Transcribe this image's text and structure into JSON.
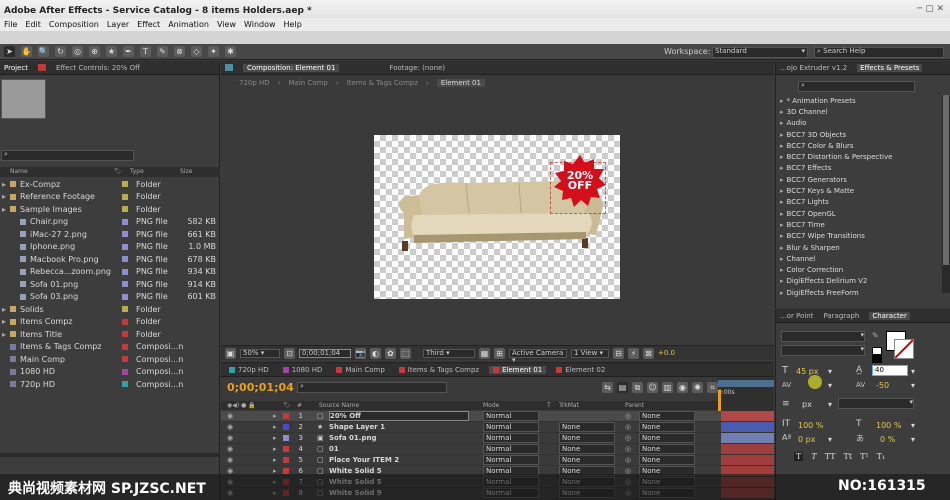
{
  "window": {
    "title": "Adobe After Effects - Service Catalog - 8 items Holders.aep *"
  },
  "menu": [
    "File",
    "Edit",
    "Composition",
    "Layer",
    "Effect",
    "Animation",
    "View",
    "Window",
    "Help"
  ],
  "toolbar": {
    "workspace_label": "Workspace:",
    "workspace_value": "Standard",
    "search_placeholder": "Search Help"
  },
  "project": {
    "tab_project": "Project",
    "tab_effect_controls": "Effect Controls: 20% Off",
    "search_placeholder": "",
    "headers": {
      "name": "Name",
      "type": "Type",
      "size": "Size"
    },
    "items": [
      {
        "name": "Ex-Compz",
        "type": "Folder",
        "size": "",
        "indent": 0,
        "kind": "folder",
        "color": "#b8b045"
      },
      {
        "name": "Reference Footage",
        "type": "Folder",
        "size": "",
        "indent": 0,
        "kind": "folder",
        "color": "#b8b045"
      },
      {
        "name": "Sample Images",
        "type": "Folder",
        "size": "",
        "indent": 0,
        "kind": "folder",
        "color": "#b8b045"
      },
      {
        "name": "Chair.png",
        "type": "PNG file",
        "size": "582 KB",
        "indent": 1,
        "kind": "file",
        "color": "#8e8ecf"
      },
      {
        "name": "iMac-27 2.png",
        "type": "PNG file",
        "size": "661 KB",
        "indent": 1,
        "kind": "file",
        "color": "#8e8ecf"
      },
      {
        "name": "Iphone.png",
        "type": "PNG file",
        "size": "1.0 MB",
        "indent": 1,
        "kind": "file",
        "color": "#8e8ecf"
      },
      {
        "name": "Macbook Pro.png",
        "type": "PNG file",
        "size": "678 KB",
        "indent": 1,
        "kind": "file",
        "color": "#8e8ecf"
      },
      {
        "name": "Rebecca...zoom.png",
        "type": "PNG file",
        "size": "934 KB",
        "indent": 1,
        "kind": "file",
        "color": "#8e8ecf"
      },
      {
        "name": "Sofa 01.png",
        "type": "PNG file",
        "size": "914 KB",
        "indent": 1,
        "kind": "file",
        "color": "#8e8ecf"
      },
      {
        "name": "Sofa 03.png",
        "type": "PNG file",
        "size": "601 KB",
        "indent": 1,
        "kind": "file",
        "color": "#8e8ecf"
      },
      {
        "name": "Solids",
        "type": "Folder",
        "size": "",
        "indent": 0,
        "kind": "folder",
        "color": "#b8b045"
      },
      {
        "name": "Items Compz",
        "type": "Folder",
        "size": "",
        "indent": 0,
        "kind": "folder",
        "color": "#c23b3b"
      },
      {
        "name": "Items Title",
        "type": "Folder",
        "size": "",
        "indent": 0,
        "kind": "folder",
        "color": "#c23b3b"
      },
      {
        "name": "Items & Tags Compz",
        "type": "Composi...n",
        "size": "",
        "indent": 0,
        "kind": "comp",
        "color": "#c23b3b"
      },
      {
        "name": "Main Comp",
        "type": "Composi...n",
        "size": "",
        "indent": 0,
        "kind": "comp",
        "color": "#c23b3b"
      },
      {
        "name": "1080 HD",
        "type": "Composi...n",
        "size": "",
        "indent": 0,
        "kind": "comp",
        "color": "#a742a7"
      },
      {
        "name": "720p HD",
        "type": "Composi...n",
        "size": "",
        "indent": 0,
        "kind": "comp",
        "color": "#2fa3a3"
      }
    ]
  },
  "comp_viewer": {
    "tab_comp": "Composition: Element 01",
    "tab_footage": "Footage: (none)",
    "breadcrumbs": [
      "720p HD",
      "Main Comp",
      "Items & Tags Compz",
      "Element 01"
    ],
    "badge": "20% OFF",
    "zoom": "50%",
    "time": "0;00;01;04",
    "resolution": "Third",
    "camera": "Active Camera",
    "view": "1 View",
    "exposure": "+0.0"
  },
  "timeline": {
    "tabs": [
      "720p HD",
      "1080 HD",
      "Main Comp",
      "Items & Tags Compz",
      "Element 01",
      "Element 02"
    ],
    "active_tab": "Element 01",
    "current_time": "0;00;01;04",
    "search_placeholder": "",
    "headers": {
      "source": "Source Name",
      "mode": "Mode",
      "t": "T",
      "trkmat": "TrkMat",
      "parent": "Parent"
    },
    "ruler_start": "0:00s",
    "layers": [
      {
        "num": "1",
        "name": "20% Off",
        "mode": "Normal",
        "trkmat": "",
        "parent": "None",
        "color": "#c23b3b",
        "bar": "#b04848",
        "selected": true
      },
      {
        "num": "2",
        "name": "Shape Layer 1",
        "mode": "Normal",
        "trkmat": "None",
        "parent": "None",
        "color": "#4a4acf",
        "bar": "#4a5cb0",
        "selected": false
      },
      {
        "num": "3",
        "name": "Sofa 01.png",
        "mode": "Normal",
        "trkmat": "None",
        "parent": "None",
        "color": "#8e8ecf",
        "bar": "#6f7fb0",
        "selected": false
      },
      {
        "num": "4",
        "name": "01",
        "mode": "Normal",
        "trkmat": "None",
        "parent": "None",
        "color": "#c23b3b",
        "bar": "#a03d3d",
        "selected": false
      },
      {
        "num": "5",
        "name": "Place Your ITEM 2",
        "mode": "Normal",
        "trkmat": "None",
        "parent": "None",
        "color": "#c23b3b",
        "bar": "#a03d3d",
        "selected": false
      },
      {
        "num": "6",
        "name": "White Solid 5",
        "mode": "Normal",
        "trkmat": "None",
        "parent": "None",
        "color": "#c23b3b",
        "bar": "#a03d3d",
        "selected": false
      },
      {
        "num": "7",
        "name": "White Solid 5",
        "mode": "Normal",
        "trkmat": "None",
        "parent": "None",
        "color": "#c23b3b",
        "bar": "#a03d3d",
        "selected": false
      },
      {
        "num": "8",
        "name": "White Solid 9",
        "mode": "Normal",
        "trkmat": "None",
        "parent": "None",
        "color": "#c23b3b",
        "bar": "#a03d3d",
        "selected": false
      }
    ]
  },
  "effects": {
    "tab_extruder": "...ojo Extruder v1.2",
    "tab_effects": "Effects & Presets",
    "search_placeholder": "",
    "items": [
      "* Animation Presets",
      "3D Channel",
      "Audio",
      "BCC7 3D Objects",
      "BCC7 Color & Blurs",
      "BCC7 Distortion & Perspective",
      "BCC7 Effects",
      "BCC7 Generators",
      "BCC7 Keys & Matte",
      "BCC7 Lights",
      "BCC7 OpenGL",
      "BCC7 Time",
      "BCC7 Wipe Transitions",
      "Blur & Sharpen",
      "Channel",
      "Color Correction",
      "DigiEffects Delirium V2",
      "DigiEffects FreeForm"
    ]
  },
  "character": {
    "tabs": [
      "...or Point",
      "Paragraph",
      "Character"
    ],
    "active": "Character",
    "font_size": "45 px",
    "leading": "40",
    "kerning": "",
    "tracking": "-50",
    "unit": "px",
    "vscale": "100 %",
    "hscale": "100 %",
    "baseline": "0 px",
    "tsume": "0 %",
    "styles": [
      "T",
      "T",
      "TT",
      "Tt",
      "T¹",
      "T₁"
    ]
  },
  "watermark": {
    "left": "典尚视频素材网 SP.JZSC.NET",
    "right": "NO:161315"
  }
}
